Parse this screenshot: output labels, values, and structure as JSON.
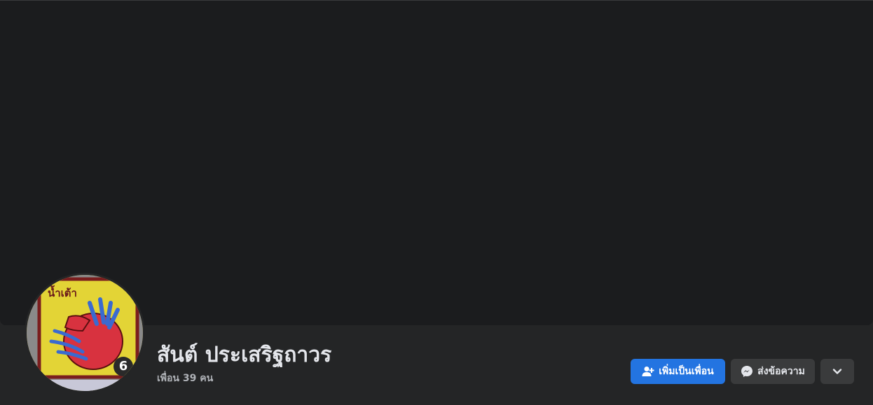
{
  "profile": {
    "name": "สันต์ ประเสริฐถาวร",
    "friends_text": "เพื่อน 39 คน"
  },
  "avatar": {
    "label": "น้ำเต้า",
    "number": "6"
  },
  "actions": {
    "add_friend_label": "เพิ่มเป็นเพื่อน",
    "message_label": "ส่งข้อความ",
    "more_icon": "chevron-down-icon"
  },
  "colors": {
    "primary_button": "#2374e1",
    "secondary_button": "#3a3b3c",
    "background": "#242526",
    "cover": "#1b1c1e"
  }
}
